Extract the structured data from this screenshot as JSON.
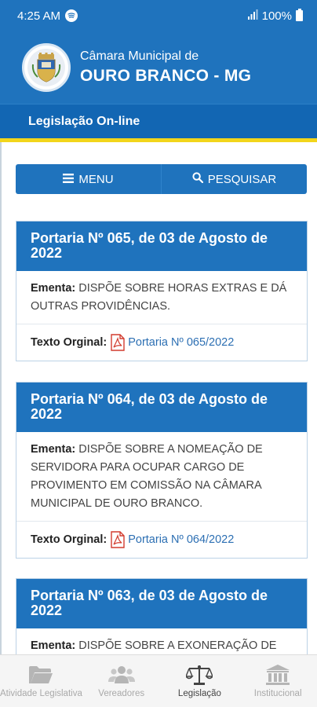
{
  "status": {
    "time": "4:25 AM",
    "battery": "100%"
  },
  "header": {
    "subtitle": "Câmara Municipal de",
    "title": "OURO BRANCO - MG"
  },
  "section": {
    "title": "Legislação On-line"
  },
  "actions": {
    "menu": "MENU",
    "search": "PESQUISAR"
  },
  "labels": {
    "ementa": "Ementa:",
    "texto": "Texto Orginal:"
  },
  "cards": [
    {
      "title": "Portaria Nº 065, de 03 de Agosto de 2022",
      "ementa": "DISPÕE SOBRE HORAS EXTRAS E DÁ OUTRAS PROVIDÊNCIAS.",
      "link": "Portaria Nº 065/2022"
    },
    {
      "title": "Portaria Nº 064, de 03 de Agosto de 2022",
      "ementa": "DISPÕE SOBRE A NOMEAÇÃO DE SERVIDORA PARA OCUPAR CARGO DE PROVIMENTO EM COMISSÃO NA CÂMARA MUNICIPAL DE OURO BRANCO.",
      "link": "Portaria Nº 064/2022"
    },
    {
      "title": "Portaria Nº 063, de 03 de Agosto de 2022",
      "ementa": "DISPÕE SOBRE A EXONERAÇÃO DE",
      "link": ""
    }
  ],
  "nav": [
    {
      "label": "Atividade Legislativa",
      "icon": "folder-open-icon",
      "active": false
    },
    {
      "label": "Vereadores",
      "icon": "group-icon",
      "active": false
    },
    {
      "label": "Legislação",
      "icon": "scales-icon",
      "active": true
    },
    {
      "label": "Institucional",
      "icon": "institution-icon",
      "active": false
    }
  ],
  "colors": {
    "primary": "#1f73bd",
    "accent": "#f2d51b",
    "link": "#2c6fb3"
  }
}
